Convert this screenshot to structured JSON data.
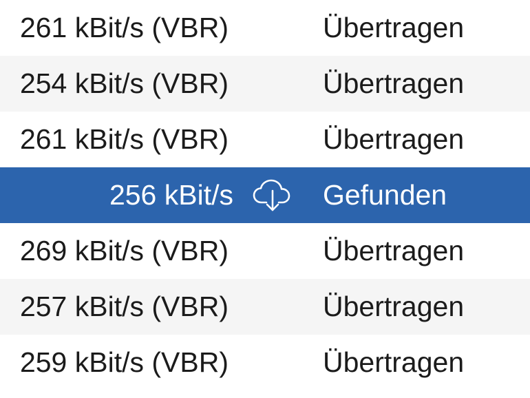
{
  "table": {
    "rows": [
      {
        "bitrate": "261 kBit/s (VBR)",
        "status": "Übertragen"
      },
      {
        "bitrate": "254 kBit/s (VBR)",
        "status": "Übertragen"
      },
      {
        "bitrate": "261 kBit/s (VBR)",
        "status": "Übertragen"
      },
      {
        "bitrate": "256 kBit/s",
        "status": "Gefunden",
        "selected": true,
        "icon": "cloud-download-icon"
      },
      {
        "bitrate": "269 kBit/s (VBR)",
        "status": "Übertragen"
      },
      {
        "bitrate": "257 kBit/s (VBR)",
        "status": "Übertragen"
      },
      {
        "bitrate": "259 kBit/s (VBR)",
        "status": "Übertragen"
      }
    ]
  },
  "colors": {
    "selection": "#2c64ad",
    "stripe": "#f5f5f5",
    "text": "#1b1b1b"
  }
}
